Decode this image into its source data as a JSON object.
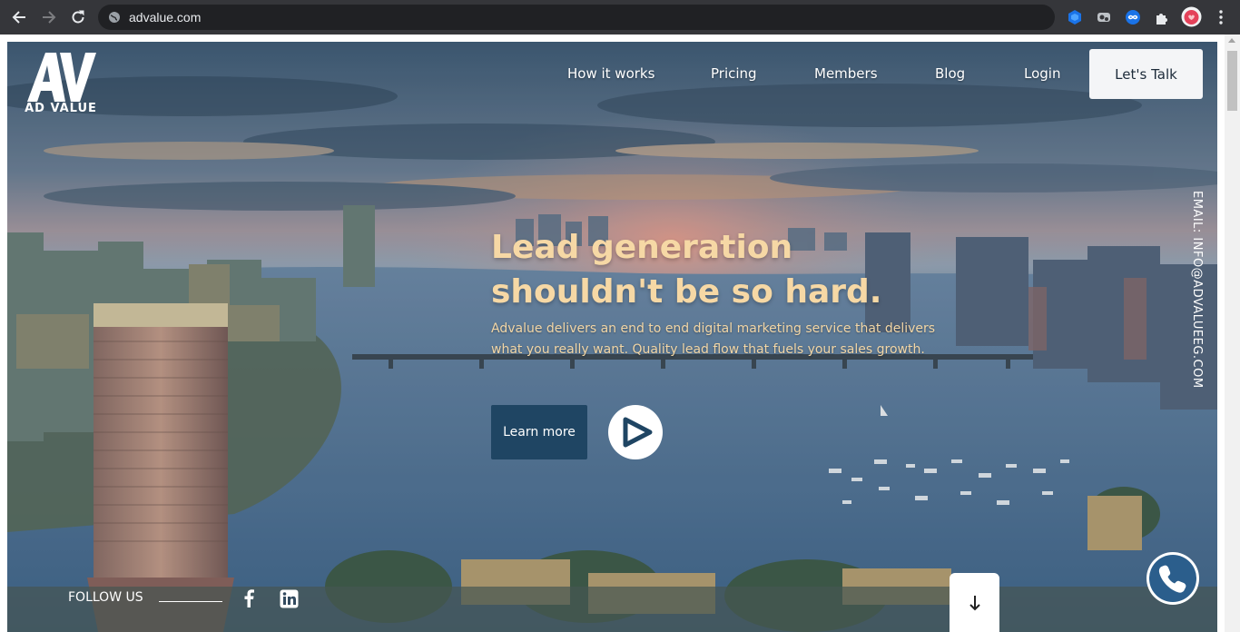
{
  "browser": {
    "url": "advalue.com"
  },
  "logo": {
    "text": "AD VALUE"
  },
  "nav": {
    "items": [
      {
        "label": "How it works"
      },
      {
        "label": "Pricing"
      },
      {
        "label": "Members"
      },
      {
        "label": "Blog"
      },
      {
        "label": "Login"
      }
    ],
    "cta_label": "Let's Talk"
  },
  "hero": {
    "headline_line1": "Lead generation",
    "headline_line2": "shouldn't be so hard.",
    "subtext": "Advalue delivers an end to end digital marketing service that delivers what you really want. Quality lead flow that fuels your sales growth.",
    "learn_more_label": "Learn more"
  },
  "side_email": "EMAIL: INFO@ADVALUEEG.COM",
  "footer": {
    "follow_label": "FOLLOW US"
  },
  "colors": {
    "headline": "#f6d8a5",
    "button_primary": "#1f4563",
    "cta_bg": "#f4f5f7"
  }
}
